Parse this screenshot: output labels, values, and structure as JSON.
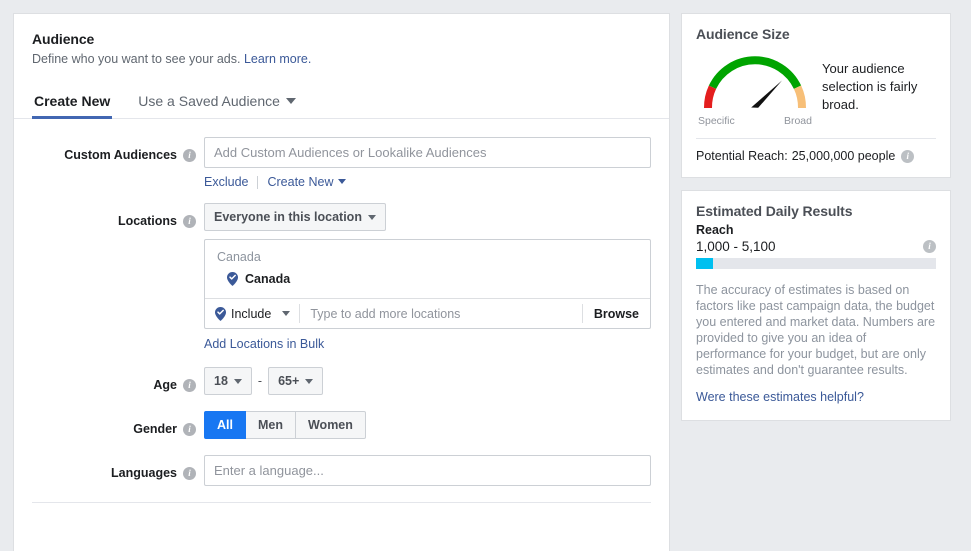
{
  "audience_card": {
    "title": "Audience",
    "subtitle": "Define who you want to see your ads.",
    "learn_more": "Learn more.",
    "tabs": [
      {
        "label": "Create New",
        "active": true
      },
      {
        "label": "Use a Saved Audience",
        "active": false,
        "has_caret": true
      }
    ],
    "custom_audiences": {
      "label": "Custom Audiences",
      "placeholder": "Add Custom Audiences or Lookalike Audiences",
      "value": "",
      "exclude_link": "Exclude",
      "create_new_link": "Create New"
    },
    "locations": {
      "label": "Locations",
      "scope_button": "Everyone in this location",
      "group_header": "Canada",
      "selected_location": "Canada",
      "include_label": "Include",
      "typeahead_placeholder": "Type to add more locations",
      "typeahead_value": "",
      "browse_button": "Browse",
      "bulk_link": "Add Locations in Bulk"
    },
    "age": {
      "label": "Age",
      "min": "18",
      "max": "65+",
      "separator": "-"
    },
    "gender": {
      "label": "Gender",
      "options": [
        "All",
        "Men",
        "Women"
      ],
      "selected": "All"
    },
    "languages": {
      "label": "Languages",
      "placeholder": "Enter a language...",
      "value": ""
    }
  },
  "audience_size": {
    "title": "Audience Size",
    "gauge": {
      "left_label": "Specific",
      "right_label": "Broad",
      "needle_fraction": 0.62,
      "colors": {
        "specific": "#e41e1e",
        "middle": "#00a400",
        "broad": "#f7bf78",
        "needle": "#111111"
      }
    },
    "message": "Your audience selection is fairly broad.",
    "potential_reach_label": "Potential Reach:",
    "potential_reach_value": "25,000,000 people"
  },
  "estimated_daily_results": {
    "title": "Estimated Daily Results",
    "metric_label": "Reach",
    "metric_value": "1,000 - 5,100",
    "bar_fill_percent": 7,
    "bar_fill_color": "#00c0f0",
    "note": "The accuracy of estimates is based on factors like past campaign data, the budget you entered and market data. Numbers are provided to give you an idea of performance for your budget, but are only estimates and don't guarantee results.",
    "feedback_link": "Were these estimates helpful?"
  }
}
